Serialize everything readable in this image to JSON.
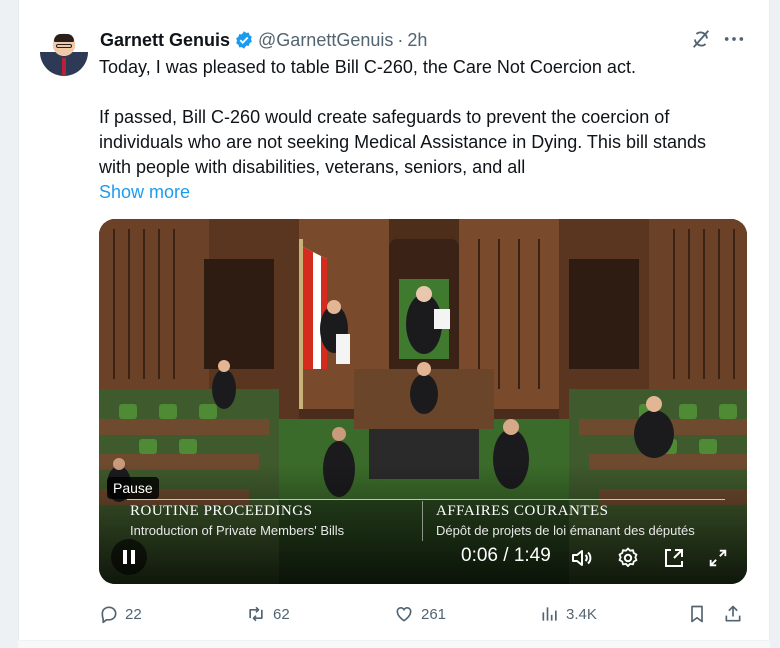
{
  "tweet": {
    "author_name": "Garnett Genuis",
    "handle": "@GarnettGenuis",
    "separator": "·",
    "time": "2h",
    "paragraph1": "Today, I was pleased to table Bill C-260, the Care Not Coercion act.",
    "paragraph2": "If passed, Bill C-260 would create safeguards to prevent the coercion of individuals who are not seeking Medical Assistance in Dying. This bill stands with people with disabilities, veterans, seniors, and all",
    "show_more": "Show more"
  },
  "video": {
    "pause_tooltip": "Pause",
    "banner_left_title": "ROUTINE PROCEEDINGS",
    "banner_left_subtitle": "Introduction of Private Members' Bills",
    "banner_right_title": "AFFAIRES COURANTES",
    "banner_right_subtitle": "Dépôt de projets de loi émanant des députés",
    "time_display": "0:06 / 1:49",
    "progress_fraction": 0.055
  },
  "actions": {
    "replies": "22",
    "reposts": "62",
    "likes": "261",
    "views": "3.4K"
  },
  "colors": {
    "accent": "#1d9bf0",
    "verified": "#1d9bf0",
    "muted": "#536471"
  },
  "icons": [
    "verified-badge-icon",
    "grok-icon",
    "more-icon",
    "pause-icon",
    "volume-icon",
    "settings-icon",
    "pip-icon",
    "fullscreen-icon",
    "reply-icon",
    "repost-icon",
    "like-icon",
    "views-icon",
    "bookmark-icon",
    "share-icon"
  ]
}
